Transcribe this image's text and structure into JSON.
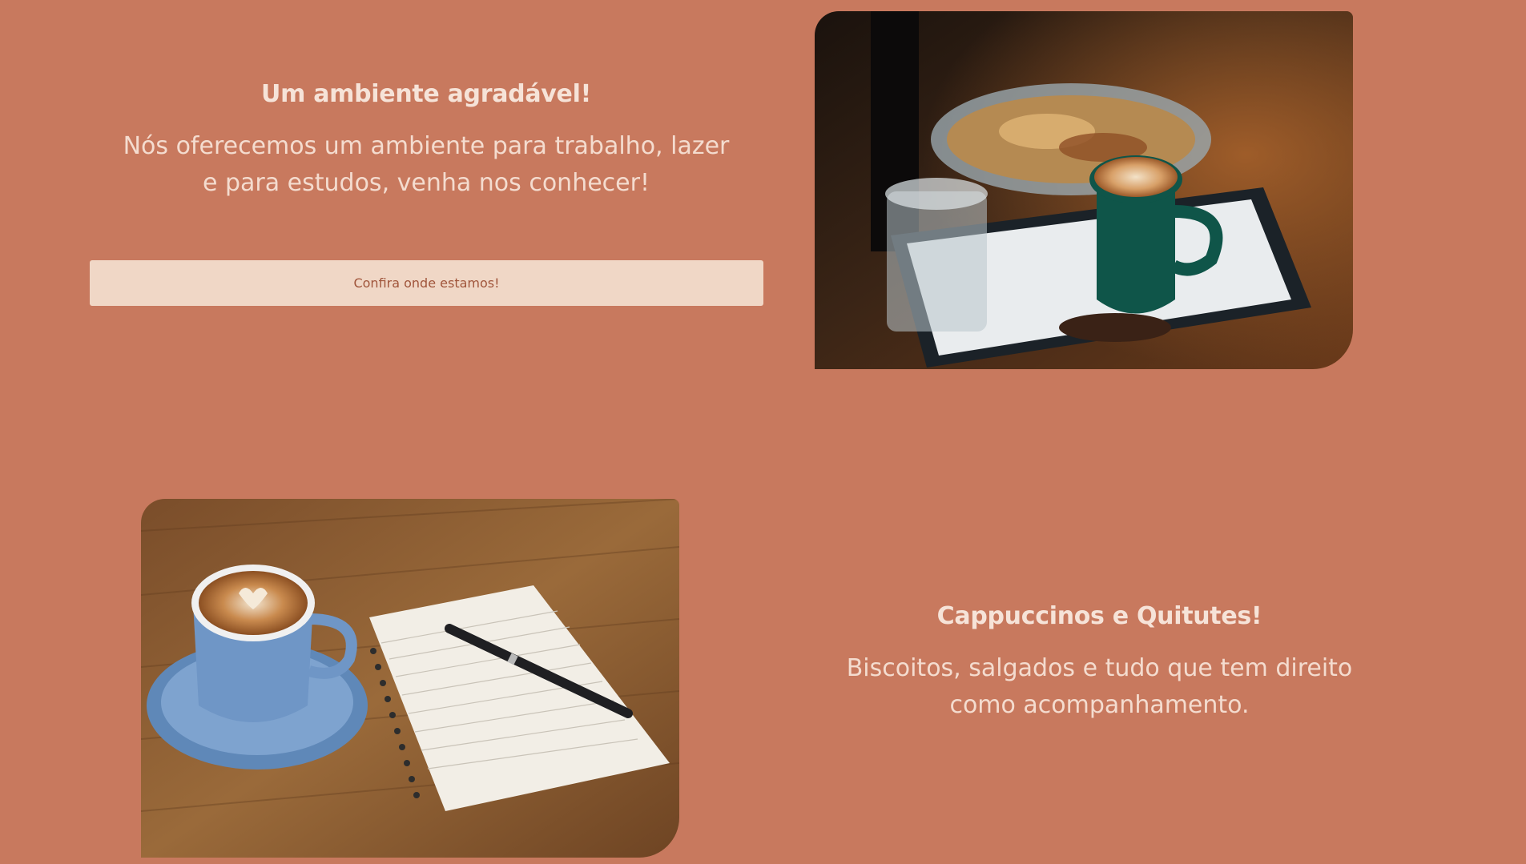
{
  "section_ambiente": {
    "heading": "Um ambiente agradável!",
    "paragraph": "Nós oferecemos um ambiente para trabalho, lazer e para estudos, venha nos conhecer!",
    "button_label": "Confira onde estamos!"
  },
  "section_cappuccinos": {
    "heading": "Cappuccinos e Quitutes!",
    "paragraph": "Biscoitos, salgados e tudo que tem direito como acompanhamento."
  },
  "colors": {
    "background": "#c8795e",
    "button_background": "#f0d7c6",
    "button_text": "#a0553b",
    "text": "#f4dccf"
  }
}
